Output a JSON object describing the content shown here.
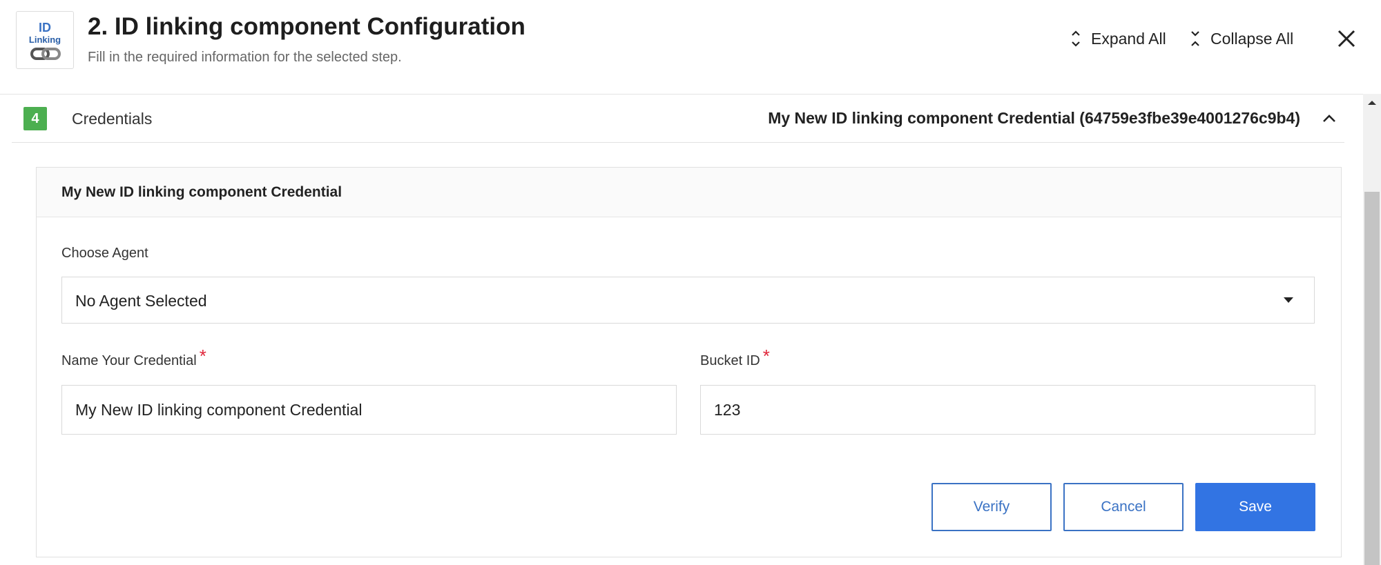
{
  "header": {
    "logo_line1": "ID",
    "logo_line2": "Linking",
    "title": "2. ID linking component Configuration",
    "subtitle": "Fill in the required information for the selected step.",
    "expand_all": "Expand All",
    "collapse_all": "Collapse All"
  },
  "section": {
    "step_number": "4",
    "label": "Credentials",
    "value": "My New ID linking component Credential (64759e3fbe39e4001276c9b4)"
  },
  "card": {
    "title": "My New ID linking component Credential",
    "agent_label": "Choose Agent",
    "agent_selected": "No Agent Selected",
    "name_label": "Name Your Credential",
    "name_value": "My New ID linking component Credential",
    "bucket_label": "Bucket ID",
    "bucket_value": "123",
    "required_mark": "*"
  },
  "actions": {
    "verify": "Verify",
    "cancel": "Cancel",
    "save": "Save"
  },
  "colors": {
    "accent": "#3274e3",
    "step_badge": "#4caf50",
    "required": "#e0263a"
  }
}
